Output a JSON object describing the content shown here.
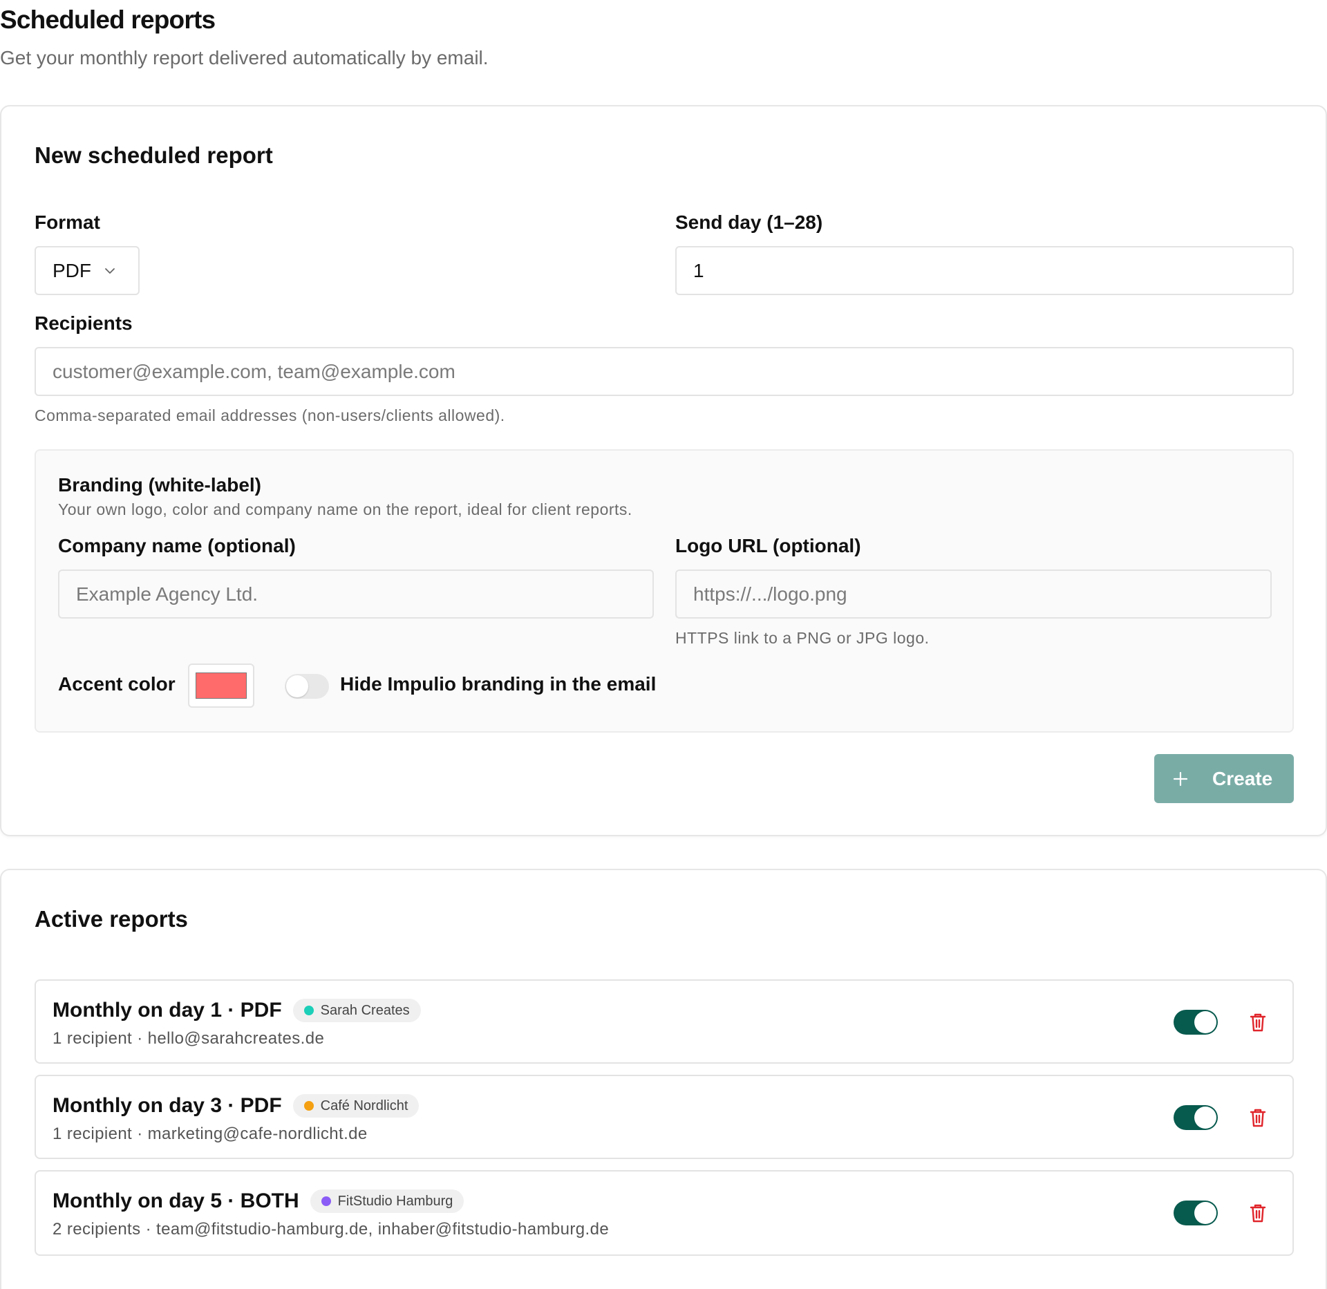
{
  "header": {
    "title": "Scheduled reports",
    "subtitle": "Get your monthly report delivered automatically by email."
  },
  "new_report": {
    "title": "New scheduled report",
    "format": {
      "label": "Format",
      "value": "PDF",
      "icon": "chevron-down-icon"
    },
    "send_day": {
      "label": "Send day (1–28)",
      "value": "1"
    },
    "recipients": {
      "label": "Recipients",
      "placeholder": "customer@example.com, team@example.com",
      "help": "Comma-separated email addresses (non-users/clients allowed)."
    },
    "branding": {
      "title": "Branding (white-label)",
      "description": "Your own logo, color and company name on the report, ideal for client reports.",
      "company_name": {
        "label": "Company name (optional)",
        "placeholder": "Example Agency Ltd."
      },
      "logo_url": {
        "label": "Logo URL (optional)",
        "placeholder": "https://.../logo.png",
        "help": "HTTPS link to a PNG or JPG logo."
      },
      "accent_color": {
        "label": "Accent color",
        "value": "#ff6b6b"
      },
      "hide_branding": {
        "label": "Hide Impulio branding in the email",
        "enabled": false
      }
    },
    "create_button": {
      "label": "Create",
      "icon": "plus-icon",
      "color": "#7aaca6"
    }
  },
  "active_reports": {
    "title": "Active reports",
    "items": [
      {
        "title": "Monthly on day 1 · PDF",
        "client": "Sarah Creates",
        "client_color": "#1ccfb8",
        "details": "1 recipient · hello@sarahcreates.de",
        "enabled": true
      },
      {
        "title": "Monthly on day 3 · PDF",
        "client": "Café Nordlicht",
        "client_color": "#f4a012",
        "details": "1 recipient · marketing@cafe-nordlicht.de",
        "enabled": true
      },
      {
        "title": "Monthly on day 5 · BOTH",
        "client": "FitStudio Hamburg",
        "client_color": "#8b5cf6",
        "details": "2 recipients · team@fitstudio-hamburg.de, inhaber@fitstudio-hamburg.de",
        "enabled": true
      }
    ],
    "toggle_color": "#075a4e",
    "delete_color": "#e0252b"
  }
}
